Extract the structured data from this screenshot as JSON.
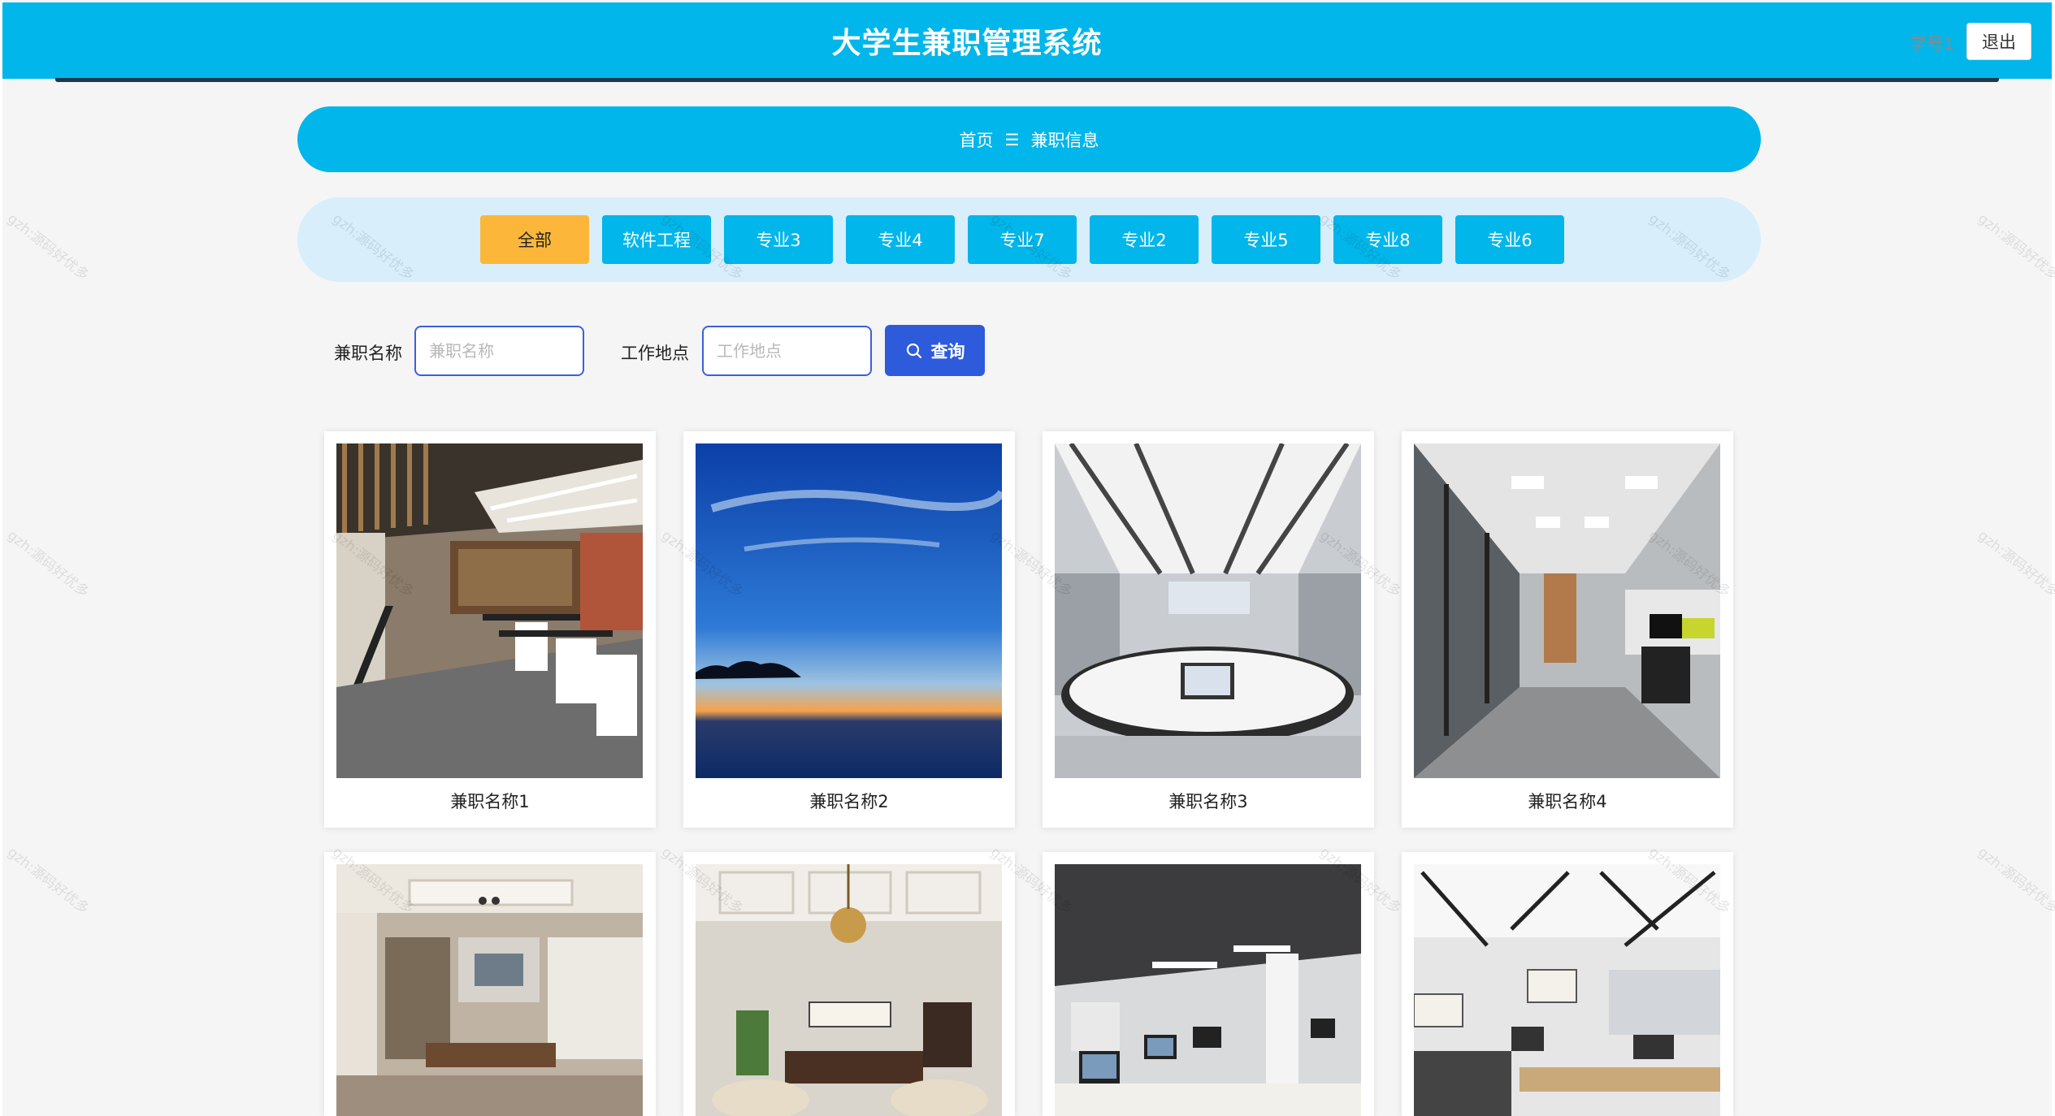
{
  "header": {
    "title": "大学生兼职管理系统",
    "user_label": "学号1",
    "logout_label": "退出",
    "bg_color": "#00b6ea"
  },
  "breadcrumb": {
    "home": "首页",
    "separator": "☰",
    "current": "兼职信息"
  },
  "categories": [
    {
      "label": "全部",
      "active": true
    },
    {
      "label": "软件工程",
      "active": false
    },
    {
      "label": "专业3",
      "active": false
    },
    {
      "label": "专业4",
      "active": false
    },
    {
      "label": "专业7",
      "active": false
    },
    {
      "label": "专业2",
      "active": false
    },
    {
      "label": "专业5",
      "active": false
    },
    {
      "label": "专业8",
      "active": false
    },
    {
      "label": "专业6",
      "active": false
    }
  ],
  "search": {
    "name_label": "兼职名称",
    "name_placeholder": "兼职名称",
    "location_label": "工作地点",
    "location_placeholder": "工作地点",
    "query_label": "查询"
  },
  "cards": [
    {
      "title": "兼职名称1",
      "image": "office-loft-photo"
    },
    {
      "title": "兼职名称2",
      "image": "lake-sunset-photo"
    },
    {
      "title": "兼职名称3",
      "image": "conference-room-photo"
    },
    {
      "title": "兼职名称4",
      "image": "office-corridor-photo"
    },
    {
      "title": "",
      "image": "executive-office-photo"
    },
    {
      "title": "",
      "image": "classic-office-photo"
    },
    {
      "title": "",
      "image": "computer-lab-photo"
    },
    {
      "title": "",
      "image": "open-office-photo"
    }
  ],
  "watermark": "gzh:源码好优多"
}
